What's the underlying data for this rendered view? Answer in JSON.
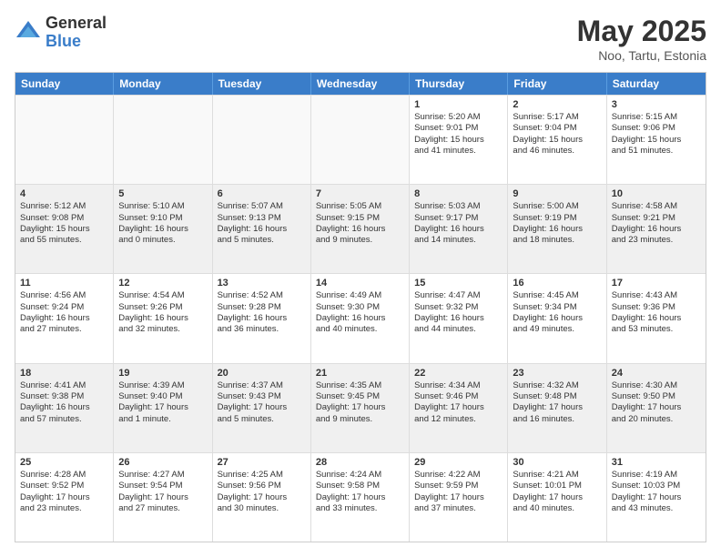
{
  "header": {
    "logo_general": "General",
    "logo_blue": "Blue",
    "title": "May 2025",
    "location": "Noo, Tartu, Estonia"
  },
  "days_of_week": [
    "Sunday",
    "Monday",
    "Tuesday",
    "Wednesday",
    "Thursday",
    "Friday",
    "Saturday"
  ],
  "weeks": [
    [
      {
        "day": "",
        "empty": true
      },
      {
        "day": "",
        "empty": true
      },
      {
        "day": "",
        "empty": true
      },
      {
        "day": "",
        "empty": true
      },
      {
        "day": "1",
        "lines": [
          "Sunrise: 5:20 AM",
          "Sunset: 9:01 PM",
          "Daylight: 15 hours",
          "and 41 minutes."
        ]
      },
      {
        "day": "2",
        "lines": [
          "Sunrise: 5:17 AM",
          "Sunset: 9:04 PM",
          "Daylight: 15 hours",
          "and 46 minutes."
        ]
      },
      {
        "day": "3",
        "lines": [
          "Sunrise: 5:15 AM",
          "Sunset: 9:06 PM",
          "Daylight: 15 hours",
          "and 51 minutes."
        ]
      }
    ],
    [
      {
        "day": "4",
        "lines": [
          "Sunrise: 5:12 AM",
          "Sunset: 9:08 PM",
          "Daylight: 15 hours",
          "and 55 minutes."
        ]
      },
      {
        "day": "5",
        "lines": [
          "Sunrise: 5:10 AM",
          "Sunset: 9:10 PM",
          "Daylight: 16 hours",
          "and 0 minutes."
        ]
      },
      {
        "day": "6",
        "lines": [
          "Sunrise: 5:07 AM",
          "Sunset: 9:13 PM",
          "Daylight: 16 hours",
          "and 5 minutes."
        ]
      },
      {
        "day": "7",
        "lines": [
          "Sunrise: 5:05 AM",
          "Sunset: 9:15 PM",
          "Daylight: 16 hours",
          "and 9 minutes."
        ]
      },
      {
        "day": "8",
        "lines": [
          "Sunrise: 5:03 AM",
          "Sunset: 9:17 PM",
          "Daylight: 16 hours",
          "and 14 minutes."
        ]
      },
      {
        "day": "9",
        "lines": [
          "Sunrise: 5:00 AM",
          "Sunset: 9:19 PM",
          "Daylight: 16 hours",
          "and 18 minutes."
        ]
      },
      {
        "day": "10",
        "lines": [
          "Sunrise: 4:58 AM",
          "Sunset: 9:21 PM",
          "Daylight: 16 hours",
          "and 23 minutes."
        ]
      }
    ],
    [
      {
        "day": "11",
        "lines": [
          "Sunrise: 4:56 AM",
          "Sunset: 9:24 PM",
          "Daylight: 16 hours",
          "and 27 minutes."
        ]
      },
      {
        "day": "12",
        "lines": [
          "Sunrise: 4:54 AM",
          "Sunset: 9:26 PM",
          "Daylight: 16 hours",
          "and 32 minutes."
        ]
      },
      {
        "day": "13",
        "lines": [
          "Sunrise: 4:52 AM",
          "Sunset: 9:28 PM",
          "Daylight: 16 hours",
          "and 36 minutes."
        ]
      },
      {
        "day": "14",
        "lines": [
          "Sunrise: 4:49 AM",
          "Sunset: 9:30 PM",
          "Daylight: 16 hours",
          "and 40 minutes."
        ]
      },
      {
        "day": "15",
        "lines": [
          "Sunrise: 4:47 AM",
          "Sunset: 9:32 PM",
          "Daylight: 16 hours",
          "and 44 minutes."
        ]
      },
      {
        "day": "16",
        "lines": [
          "Sunrise: 4:45 AM",
          "Sunset: 9:34 PM",
          "Daylight: 16 hours",
          "and 49 minutes."
        ]
      },
      {
        "day": "17",
        "lines": [
          "Sunrise: 4:43 AM",
          "Sunset: 9:36 PM",
          "Daylight: 16 hours",
          "and 53 minutes."
        ]
      }
    ],
    [
      {
        "day": "18",
        "lines": [
          "Sunrise: 4:41 AM",
          "Sunset: 9:38 PM",
          "Daylight: 16 hours",
          "and 57 minutes."
        ]
      },
      {
        "day": "19",
        "lines": [
          "Sunrise: 4:39 AM",
          "Sunset: 9:40 PM",
          "Daylight: 17 hours",
          "and 1 minute."
        ]
      },
      {
        "day": "20",
        "lines": [
          "Sunrise: 4:37 AM",
          "Sunset: 9:43 PM",
          "Daylight: 17 hours",
          "and 5 minutes."
        ]
      },
      {
        "day": "21",
        "lines": [
          "Sunrise: 4:35 AM",
          "Sunset: 9:45 PM",
          "Daylight: 17 hours",
          "and 9 minutes."
        ]
      },
      {
        "day": "22",
        "lines": [
          "Sunrise: 4:34 AM",
          "Sunset: 9:46 PM",
          "Daylight: 17 hours",
          "and 12 minutes."
        ]
      },
      {
        "day": "23",
        "lines": [
          "Sunrise: 4:32 AM",
          "Sunset: 9:48 PM",
          "Daylight: 17 hours",
          "and 16 minutes."
        ]
      },
      {
        "day": "24",
        "lines": [
          "Sunrise: 4:30 AM",
          "Sunset: 9:50 PM",
          "Daylight: 17 hours",
          "and 20 minutes."
        ]
      }
    ],
    [
      {
        "day": "25",
        "lines": [
          "Sunrise: 4:28 AM",
          "Sunset: 9:52 PM",
          "Daylight: 17 hours",
          "and 23 minutes."
        ]
      },
      {
        "day": "26",
        "lines": [
          "Sunrise: 4:27 AM",
          "Sunset: 9:54 PM",
          "Daylight: 17 hours",
          "and 27 minutes."
        ]
      },
      {
        "day": "27",
        "lines": [
          "Sunrise: 4:25 AM",
          "Sunset: 9:56 PM",
          "Daylight: 17 hours",
          "and 30 minutes."
        ]
      },
      {
        "day": "28",
        "lines": [
          "Sunrise: 4:24 AM",
          "Sunset: 9:58 PM",
          "Daylight: 17 hours",
          "and 33 minutes."
        ]
      },
      {
        "day": "29",
        "lines": [
          "Sunrise: 4:22 AM",
          "Sunset: 9:59 PM",
          "Daylight: 17 hours",
          "and 37 minutes."
        ]
      },
      {
        "day": "30",
        "lines": [
          "Sunrise: 4:21 AM",
          "Sunset: 10:01 PM",
          "Daylight: 17 hours",
          "and 40 minutes."
        ]
      },
      {
        "day": "31",
        "lines": [
          "Sunrise: 4:19 AM",
          "Sunset: 10:03 PM",
          "Daylight: 17 hours",
          "and 43 minutes."
        ]
      }
    ]
  ]
}
